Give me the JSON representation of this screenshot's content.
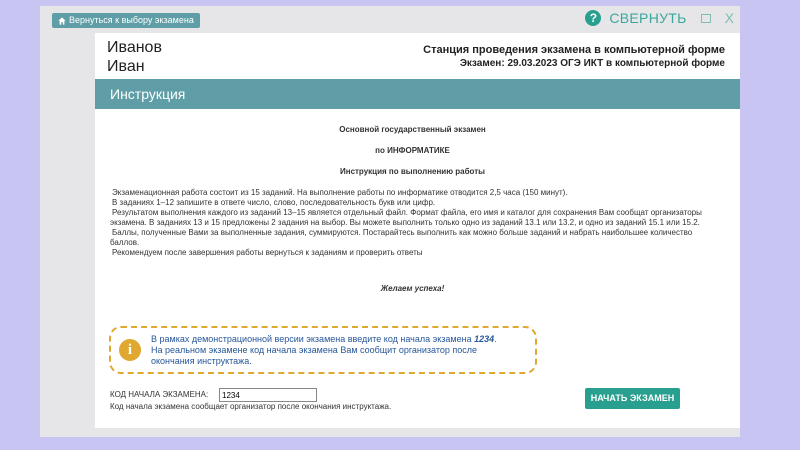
{
  "top_bar": {
    "back_label": "Вернуться к выбору экзамена",
    "help_label": "?",
    "collapse_label": "СВЕРНУТЬ",
    "close_label": "X"
  },
  "header": {
    "surname": "Иванов",
    "first_name": "Иван",
    "station_title": "Станция проведения экзамена в компьютерной форме",
    "exam_line": "Экзамен: 29.03.2023 ОГЭ ИКТ в компьютерной форме"
  },
  "section_title": "Инструкция",
  "instruction": {
    "heading1": "Основной государственный экзамен",
    "heading2": "по ИНФОРМАТИКЕ",
    "heading3": "Инструкция по выполнению работы",
    "p1": "Экзаменационная работа состоит из 15 заданий. На выполнение работы по информатике отводится 2,5 часа (150 минут).",
    "p2": "В заданиях 1–12 запишите в ответе число, слово, последовательность букв или цифр.",
    "p3": "Результатом выполнения каждого из заданий 13–15 является отдельный файл. Формат файла, его имя и каталог для сохранения Вам сообщат организаторы экзамена. В заданиях 13 и 15 предложены 2 задания на выбор. Вы можете выполнить только одно из заданий 13.1 или 13.2, и одно из заданий 15.1 или 15.2.",
    "p4": "Баллы, полученные Вами за выполненные задания, суммируются. Постарайтесь выполнить как можно больше заданий и набрать наибольшее количество баллов.",
    "p5": "Рекомендуем после завершения работы вернуться к заданиям и проверить ответы",
    "wish": "Желаем успеха!"
  },
  "notice": {
    "icon": "i",
    "line1_prefix": "В рамках демонстрационной версии экзамена введите код начала экзамена ",
    "line1_code": "1234",
    "line1_suffix": ".",
    "line2": "На реальном экзамене код начала экзамена Вам сообщит организатор после",
    "line3": "окончания инструктажа."
  },
  "code_form": {
    "label": "КОД НАЧАЛА ЭКЗАМЕНА:",
    "value": "1234",
    "hint": "Код начала экзамена сообщает организатор после окончания инструктажа.",
    "start_label": "НАЧАТЬ ЭКЗАМЕН"
  },
  "colors": {
    "accent": "#29a08f",
    "bar": "#5f9ea6",
    "notice_border": "#e0a830",
    "notice_text": "#26579a",
    "background": "#c9c5f2"
  }
}
